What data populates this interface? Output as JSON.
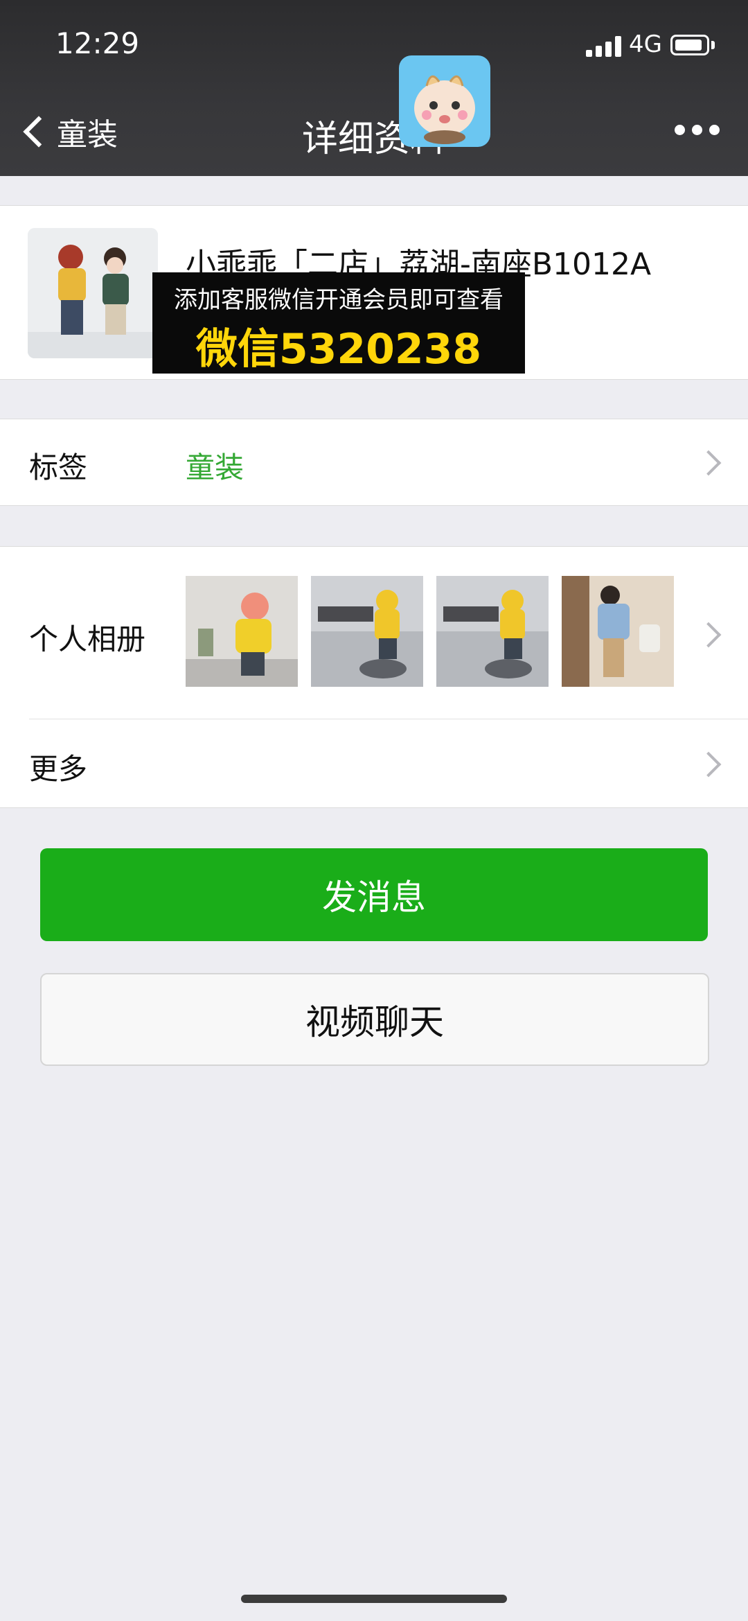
{
  "status_bar": {
    "time": "12:29",
    "network": "4G"
  },
  "nav": {
    "back_label": "童装",
    "title": "详细资料"
  },
  "profile": {
    "name": "小乖乖「二店」荔湖-南座B1012A",
    "banner_line1": "添加客服微信开通会员即可查看",
    "banner_line2": "微信5320238"
  },
  "tags_row": {
    "label": "标签",
    "value": "童装"
  },
  "album_row": {
    "label": "个人相册"
  },
  "more_row": {
    "label": "更多"
  },
  "actions": {
    "message": "发消息",
    "video_call": "视频聊天"
  },
  "colors": {
    "accent_green": "#1aad19",
    "tag_green": "#34a834",
    "banner_yellow": "#ffd60a",
    "nav_bg": "#37373a"
  }
}
